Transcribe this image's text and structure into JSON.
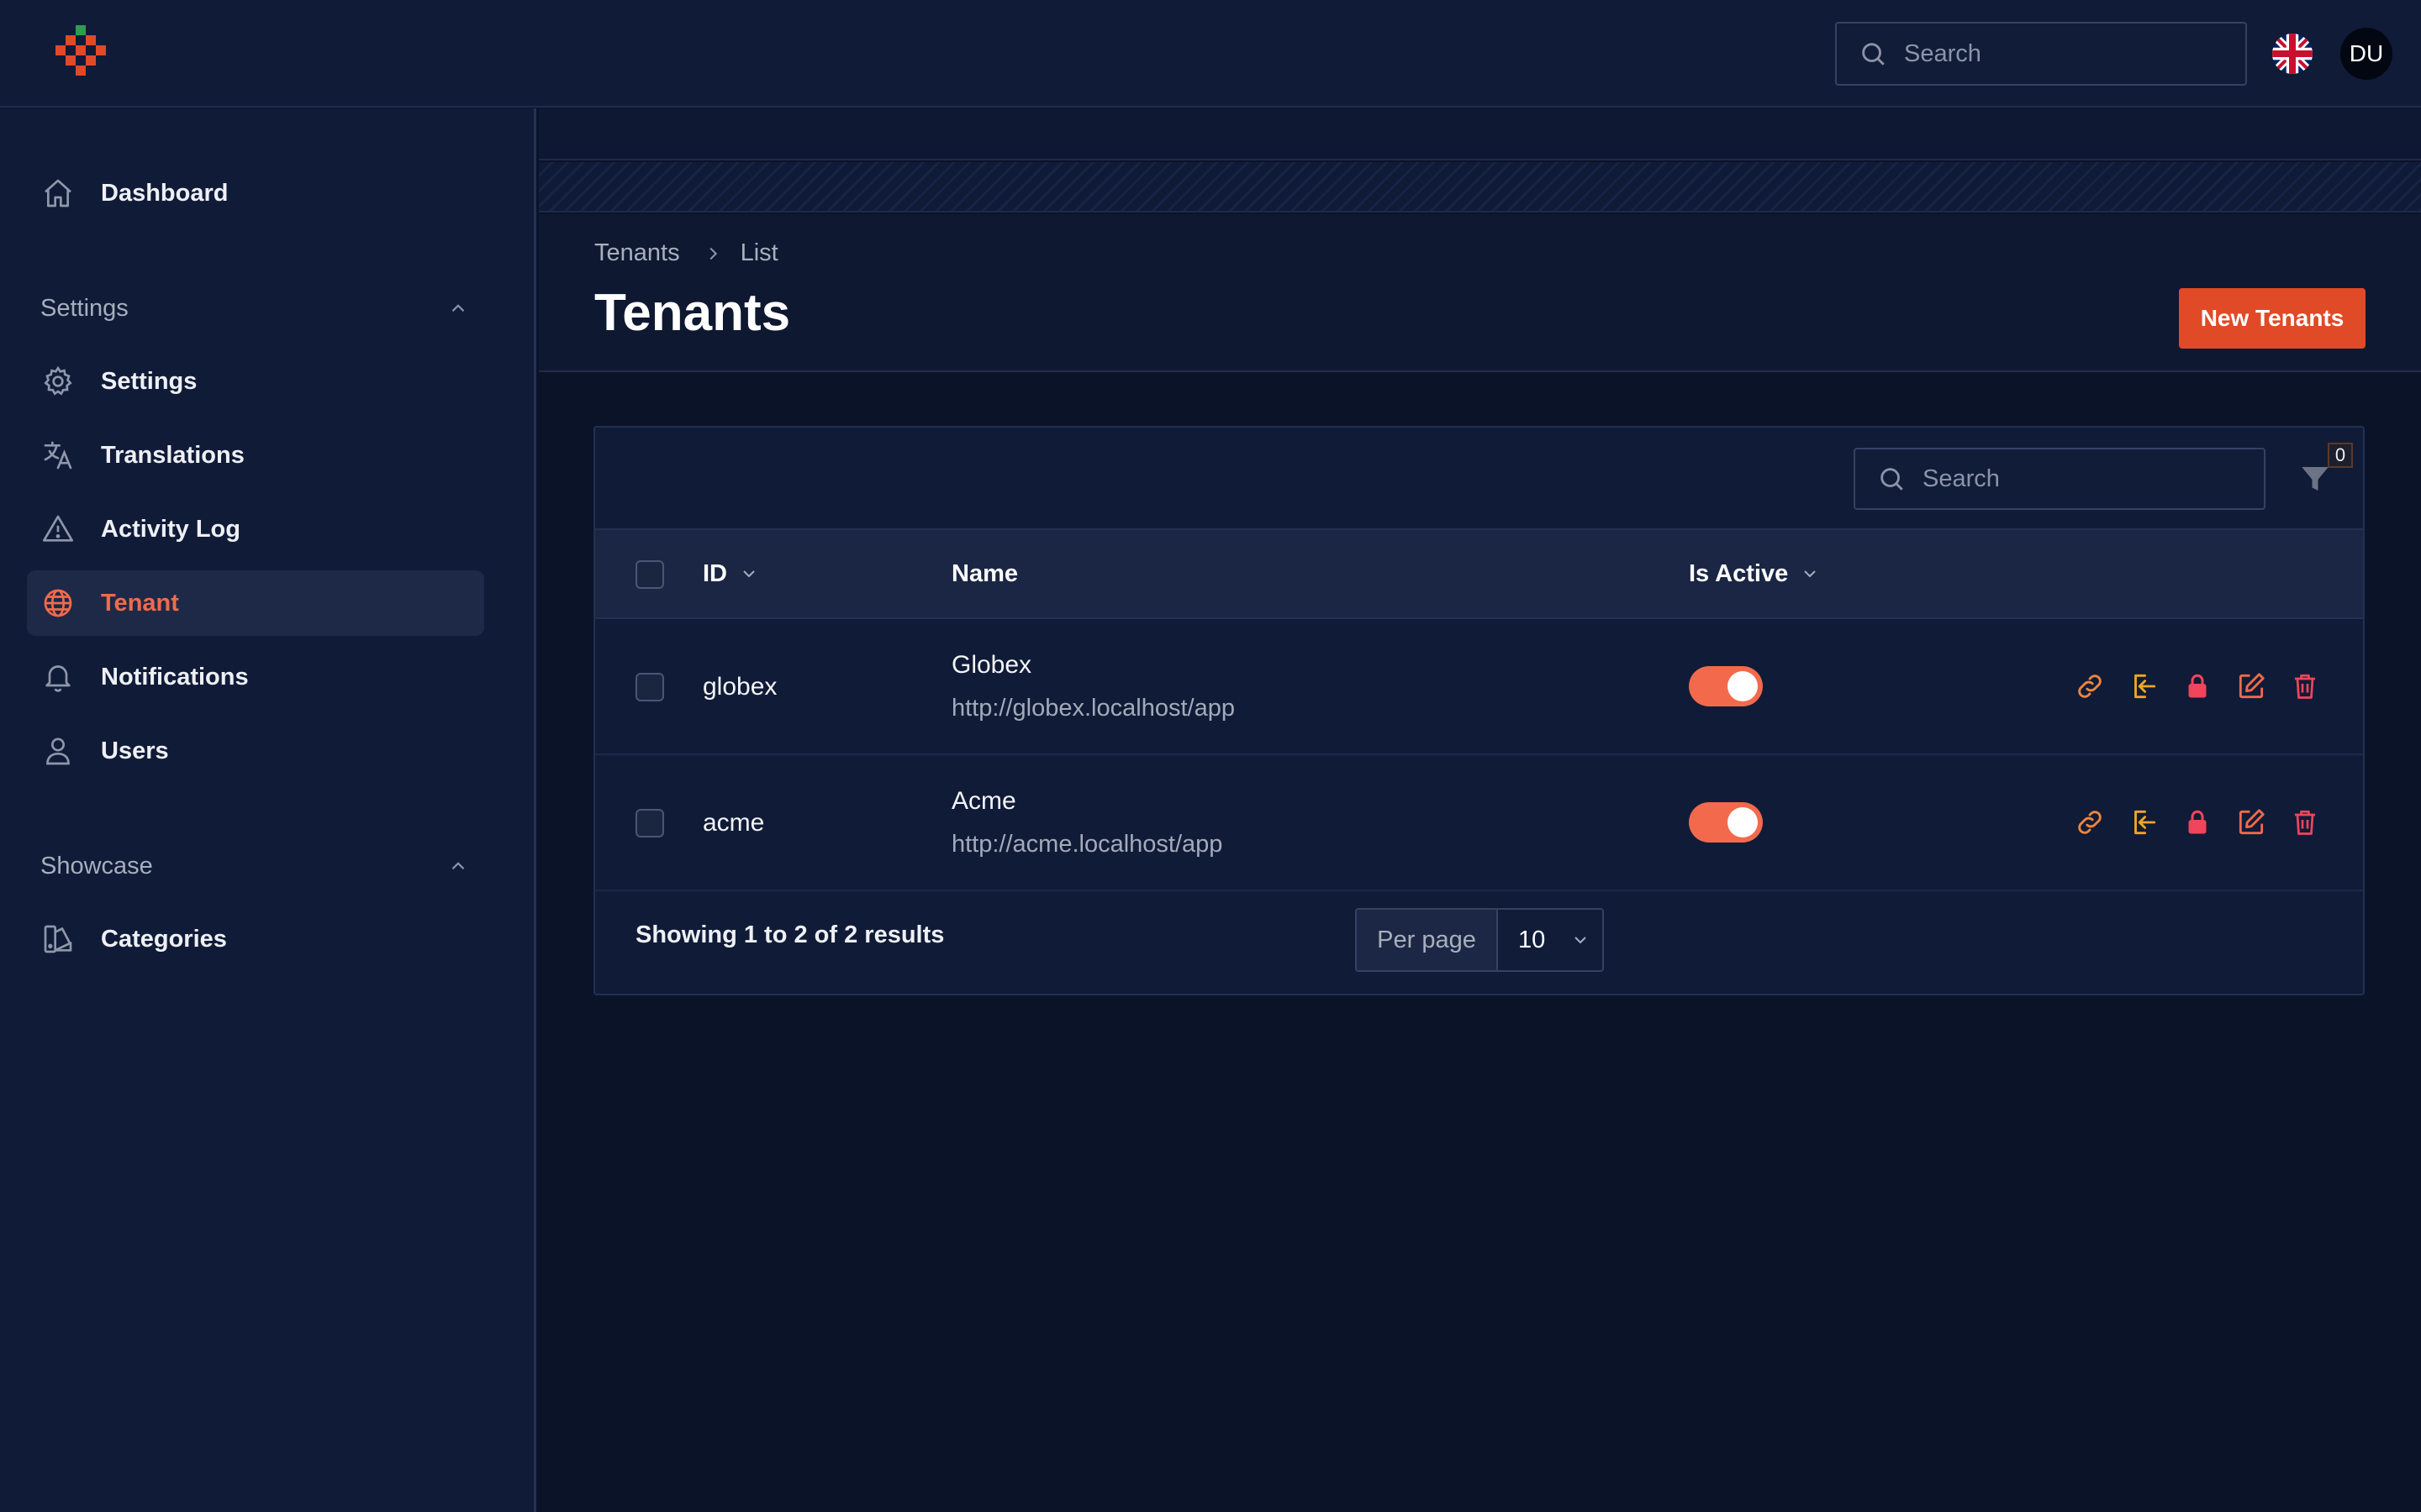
{
  "topbar": {
    "search_placeholder": "Search",
    "avatar_initials": "DU",
    "language_flag": "uk-flag-icon"
  },
  "sidebar": {
    "items": [
      {
        "label": "Dashboard",
        "icon": "home-icon"
      },
      {
        "label": "Settings",
        "icon": "gear-icon"
      },
      {
        "label": "Translations",
        "icon": "translate-icon"
      },
      {
        "label": "Activity Log",
        "icon": "warning-icon"
      },
      {
        "label": "Tenant",
        "icon": "globe-icon",
        "active": true
      },
      {
        "label": "Notifications",
        "icon": "bell-icon"
      },
      {
        "label": "Users",
        "icon": "user-icon"
      },
      {
        "label": "Categories",
        "icon": "swatch-icon"
      }
    ],
    "groups": [
      {
        "label": "Settings"
      },
      {
        "label": "Showcase"
      }
    ]
  },
  "page": {
    "breadcrumb": [
      "Tenants",
      "List"
    ],
    "title": "Tenants",
    "new_button": "New Tenants"
  },
  "table": {
    "search_placeholder": "Search",
    "filter_count": "0",
    "columns": [
      "ID",
      "Name",
      "Is Active"
    ],
    "rows": [
      {
        "id": "globex",
        "name": "Globex",
        "url": "http://globex.localhost/app",
        "active": true
      },
      {
        "id": "acme",
        "name": "Acme",
        "url": "http://acme.localhost/app",
        "active": true
      }
    ],
    "footer": "Showing 1 to 2 of 2 results",
    "per_page_label": "Per page",
    "per_page_value": "10"
  },
  "colors": {
    "accent": "#f26a4b",
    "button": "#e04a26",
    "action_orange": "#f0863c",
    "action_amber": "#f5a524",
    "action_red": "#f0455a"
  }
}
